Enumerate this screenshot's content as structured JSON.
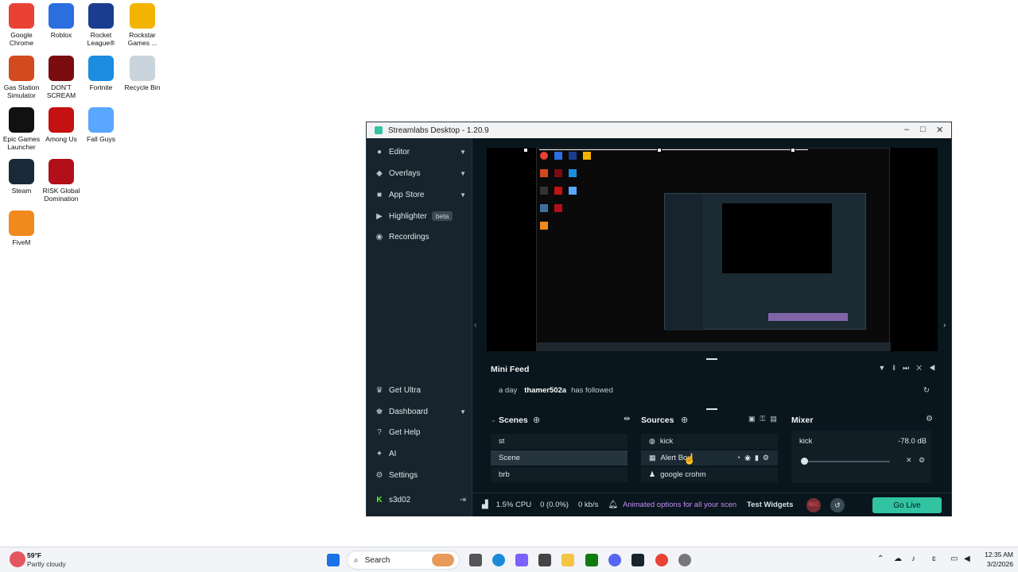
{
  "desktop": {
    "icons": [
      {
        "label": "Google Chrome",
        "icon": "chrome-icon",
        "color": "#e94235"
      },
      {
        "label": "Roblox",
        "icon": "roblox-icon",
        "color": "#2a6ee0"
      },
      {
        "label": "Rocket League®",
        "icon": "rocket-league-icon",
        "color": "#1b3d8f"
      },
      {
        "label": "Rockstar Games ...",
        "icon": "rockstar-icon",
        "color": "#f2b400"
      },
      {
        "label": "Gas Station Simulator",
        "icon": "gas-station-icon",
        "color": "#d24b1f"
      },
      {
        "label": "DON'T SCREAM",
        "icon": "dont-scream-icon",
        "color": "#7a0c10"
      },
      {
        "label": "Fortnite",
        "icon": "fortnite-icon",
        "color": "#1b8ce0"
      },
      {
        "label": "Recycle Bin",
        "icon": "recycle-bin-icon",
        "color": "#c9d4dc"
      },
      {
        "label": "Epic Games Launcher",
        "icon": "epic-games-icon",
        "color": "#111111"
      },
      {
        "label": "Among Us",
        "icon": "among-us-icon",
        "color": "#c51111"
      },
      {
        "label": "Fall Guys",
        "icon": "fall-guys-icon",
        "color": "#5aa7ff"
      },
      {
        "label": "Steam",
        "icon": "steam-icon",
        "color": "#1b2838"
      },
      {
        "label": "RISK Global Domination",
        "icon": "risk-icon",
        "color": "#b10f1a"
      },
      {
        "label": "FiveM",
        "icon": "fivem-icon",
        "color": "#f08a1c"
      }
    ]
  },
  "window": {
    "title": "Streamlabs Desktop - 1.20.9",
    "minimize": "–",
    "maximize": "□",
    "close": "✕"
  },
  "sidebar": {
    "items": [
      {
        "label": "Editor",
        "icon": "editor-icon"
      },
      {
        "label": "Overlays",
        "icon": "overlays-icon"
      },
      {
        "label": "App Store",
        "icon": "app-store-icon"
      },
      {
        "label": "Highlighter",
        "icon": "highlighter-icon",
        "badge": "beta"
      },
      {
        "label": "Recordings",
        "icon": "recordings-icon"
      }
    ],
    "bottom_items": [
      {
        "label": "Get Ultra",
        "icon": "ultra-icon"
      },
      {
        "label": "Dashboard",
        "icon": "dashboard-icon"
      },
      {
        "label": "Get Help",
        "icon": "help-icon"
      },
      {
        "label": "AI",
        "icon": "ai-icon"
      },
      {
        "label": "Settings",
        "icon": "settings-icon"
      }
    ],
    "user": "s3d02"
  },
  "minifeed": {
    "title": "Mini Feed",
    "time": "a day",
    "user": "thamer502a",
    "action": "has followed"
  },
  "scenes": {
    "title": "Scenes",
    "items": [
      "st",
      "Scene",
      "brb"
    ],
    "selected": "Scene"
  },
  "sources": {
    "title": "Sources",
    "items": [
      {
        "label": "kick",
        "icon": "globe-icon"
      },
      {
        "label": "Alert Box",
        "icon": "alert-box-icon"
      },
      {
        "label": "google crohm",
        "icon": "user-icon"
      }
    ]
  },
  "mixer": {
    "title": "Mixer",
    "channel": "kick",
    "level": "-78.0 dB"
  },
  "status": {
    "cpu": "1.5% CPU",
    "dropped": "0 (0.0%)",
    "bitrate": "0 kb/s",
    "promo": "Animated options for all your scen",
    "test_widgets": "Test Widgets",
    "rec": "REC",
    "go_live": "Go Live"
  },
  "taskbar": {
    "weather_temp": "59°F",
    "weather_desc": "Partly cloudy",
    "search": "Search",
    "time": "12:35 AM",
    "date": "3/2/2026"
  },
  "colors": {
    "accent": "#31c3a2",
    "promo": "#c48cf5"
  }
}
